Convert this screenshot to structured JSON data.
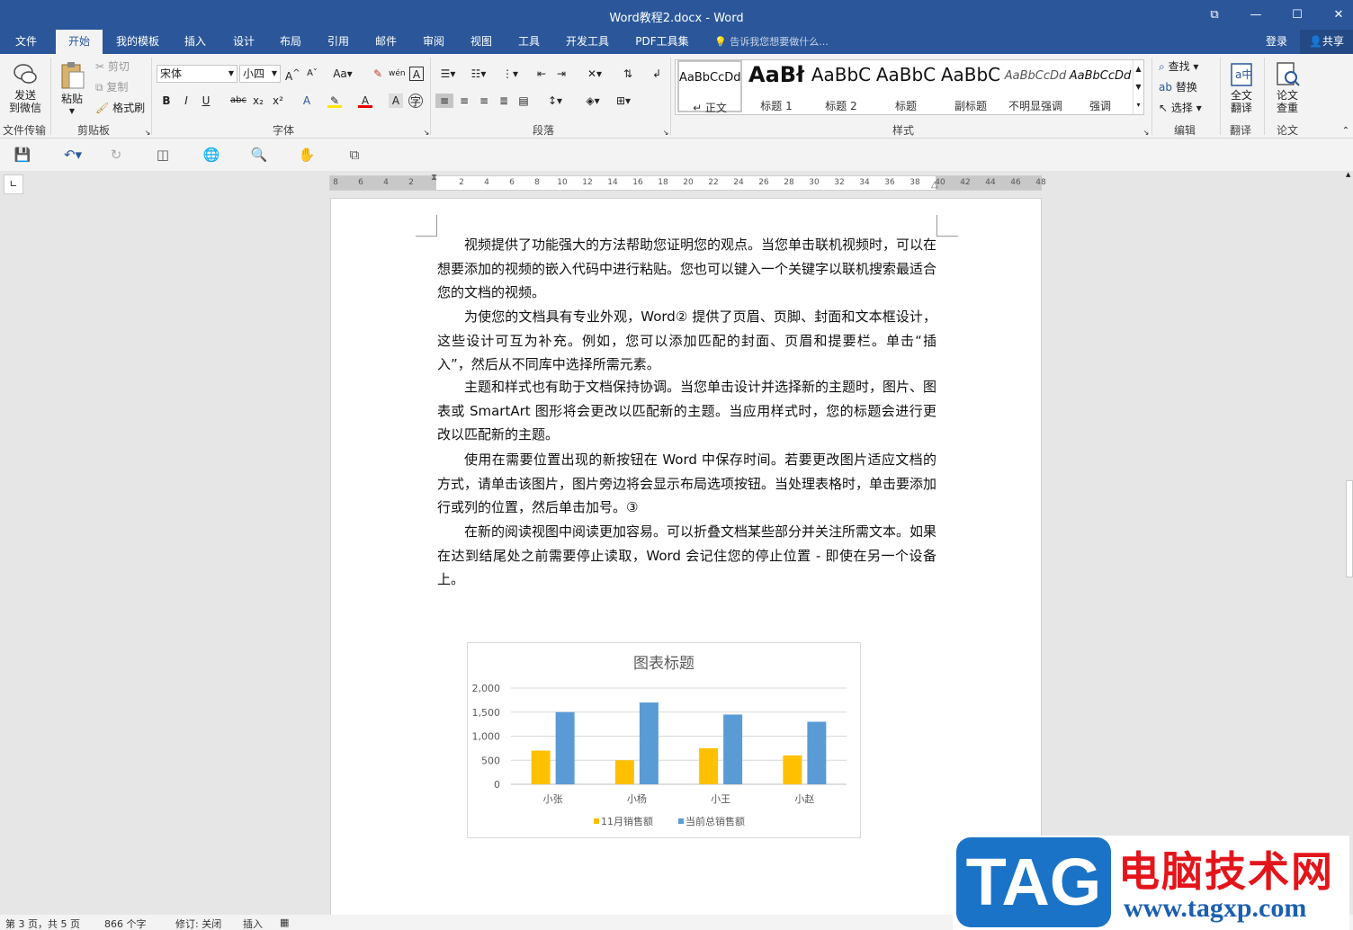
{
  "window": {
    "title": "Word教程2.docx - Word",
    "restore_glyph": "⧉",
    "minimize_glyph": "—",
    "maximize_glyph": "☐",
    "close_glyph": "✕"
  },
  "tabs": [
    "文件",
    "开始",
    "我的模板",
    "插入",
    "设计",
    "布局",
    "引用",
    "邮件",
    "审阅",
    "视图",
    "工具",
    "开发工具",
    "PDF工具集"
  ],
  "active_tab": "开始",
  "tellme": "告诉我您想要做什么...",
  "login": "登录",
  "share": "共享",
  "ribbon": {
    "send_wechat": [
      "发送",
      "到微信"
    ],
    "group_file_transfer": "文件传输",
    "paste": "粘贴",
    "cut": "剪切",
    "copy": "复制",
    "format_painter": "格式刷",
    "group_clipboard": "剪贴板",
    "font_name": "宋体",
    "font_size": "小四",
    "group_font": "字体",
    "group_paragraph": "段落",
    "styles": [
      {
        "preview": "AaBbCcDd",
        "name": "↵ 正文"
      },
      {
        "preview": "AaBł",
        "name": "标题 1"
      },
      {
        "preview": "AaBbC",
        "name": "标题 2"
      },
      {
        "preview": "AaBbC",
        "name": "标题"
      },
      {
        "preview": "AaBbC",
        "name": "副标题"
      },
      {
        "preview": "AaBbCcDd",
        "name": "不明显强调"
      },
      {
        "preview": "AaBbCcDd",
        "name": "强调"
      }
    ],
    "group_styles": "样式",
    "find": "查找",
    "replace": "替换",
    "select": "选择",
    "group_edit": "编辑",
    "full_translate": [
      "全文",
      "翻译"
    ],
    "group_translate": "翻译",
    "paper_check": [
      "论文",
      "查重"
    ],
    "group_paper": "论文"
  },
  "ruler_ticks": [
    "8",
    "6",
    "4",
    "2",
    "",
    "2",
    "4",
    "6",
    "8",
    "10",
    "12",
    "14",
    "16",
    "18",
    "20",
    "22",
    "24",
    "26",
    "28",
    "30",
    "32",
    "34",
    "36",
    "38",
    "40",
    "42",
    "44",
    "46",
    "48"
  ],
  "paragraphs": [
    "视频提供了功能强大的方法帮助您证明您的观点。当您单击联机视频时，可以在想要添加的视频的嵌入代码中进行粘贴。您也可以键入一个关键字以联机搜索最适合您的文档的视频。",
    "为使您的文档具有专业外观，Word② 提供了页眉、页脚、封面和文本框设计，这些设计可互为补充。例如，您可以添加匹配的封面、页眉和提要栏。单击“插入”，然后从不同库中选择所需元素。",
    "主题和样式也有助于文档保持协调。当您单击设计并选择新的主题时，图片、图表或 SmartArt 图形将会更改以匹配新的主题。当应用样式时，您的标题会进行更改以匹配新的主题。",
    "使用在需要位置出现的新按钮在 Word 中保存时间。若要更改图片适应文档的方式，请单击该图片，图片旁边将会显示布局选项按钮。当处理表格时，单击要添加行或列的位置，然后单击加号。③",
    "在新的阅读视图中阅读更加容易。可以折叠文档某些部分并关注所需文本。如果在达到结尾处之前需要停止读取，Word 会记住您的停止位置 - 即使在另一个设备上。"
  ],
  "chart_data": {
    "type": "bar",
    "title": "图表标题",
    "categories": [
      "小张",
      "小杨",
      "小王",
      "小赵"
    ],
    "series": [
      {
        "name": "11月销售额",
        "values": [
          700,
          500,
          750,
          600
        ],
        "color": "#ffc000"
      },
      {
        "name": "当前总销售额",
        "values": [
          1500,
          1700,
          1450,
          1300
        ],
        "color": "#5b9bd5"
      }
    ],
    "yticks": [
      "0",
      "500",
      "1,000",
      "1,500",
      "2,000"
    ],
    "ylim": [
      0,
      2000
    ],
    "grid": true,
    "legend": "bottom"
  },
  "status": {
    "page": "第 3 页，共 5 页",
    "words": "866 个字",
    "track": "修订: 关闭",
    "mode": "插入"
  },
  "watermark": {
    "tag": "TAG",
    "cn": "电脑技术网",
    "url": "www.tagxp.com"
  },
  "colors": {
    "accent": "#2b579a"
  }
}
